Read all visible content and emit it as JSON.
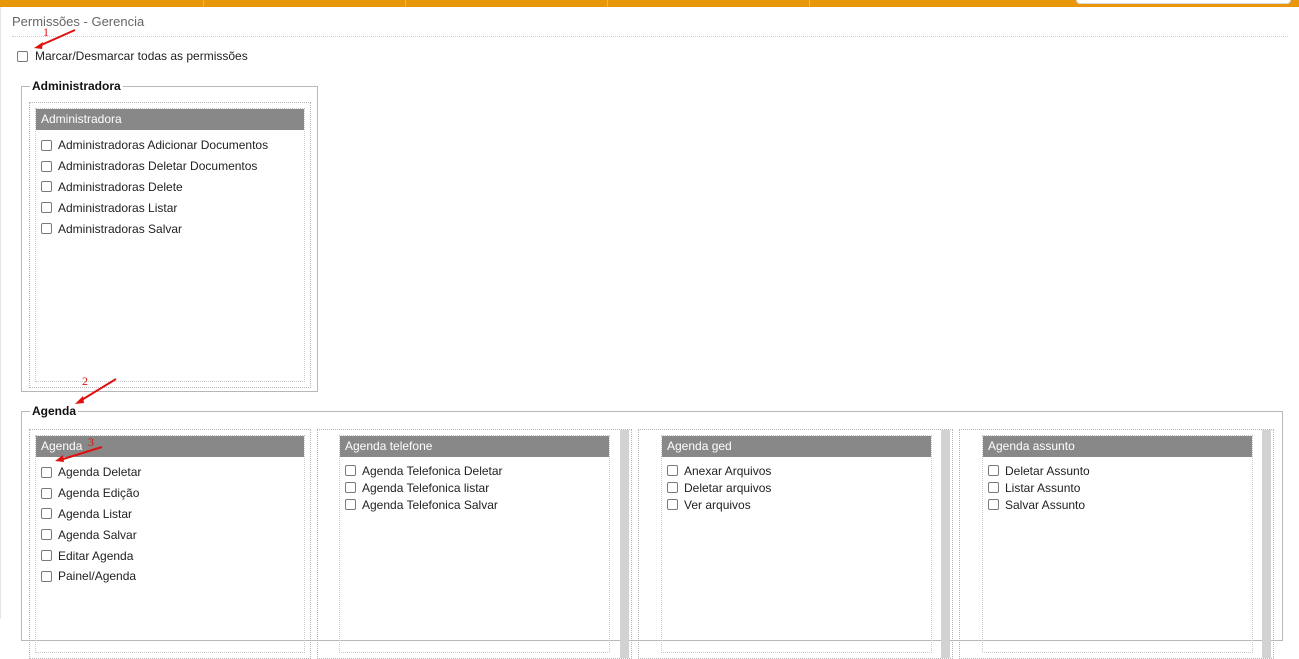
{
  "page": {
    "title": "Permissões - Gerencia"
  },
  "check_all": {
    "label": "Marcar/Desmarcar todas as permissões"
  },
  "groups": {
    "administradora": {
      "legend": "Administradora",
      "panels": [
        {
          "header": "Administradora",
          "items": [
            "Administradoras Adicionar Documentos",
            "Administradoras Deletar Documentos",
            "Administradoras Delete",
            "Administradoras Listar",
            "Administradoras Salvar"
          ]
        }
      ]
    },
    "agenda": {
      "legend": "Agenda",
      "panels": [
        {
          "header": "Agenda",
          "items": [
            "Agenda Deletar",
            "Agenda Edição",
            "Agenda Listar",
            "Agenda Salvar",
            "Editar Agenda",
            "Painel/Agenda"
          ]
        },
        {
          "header": "Agenda telefone",
          "items": [
            "Agenda Telefonica Deletar",
            "Agenda Telefonica listar",
            "Agenda Telefonica Salvar"
          ]
        },
        {
          "header": "Agenda ged",
          "items": [
            "Anexar Arquivos",
            "Deletar arquivos",
            "Ver arquivos"
          ]
        },
        {
          "header": "Agenda assunto",
          "items": [
            "Deletar Assunto",
            "Listar Assunto",
            "Salvar Assunto"
          ]
        }
      ]
    }
  },
  "annotations": {
    "m1": "1",
    "m2": "2",
    "m3": "3"
  },
  "colors": {
    "topbar": "#e8960a",
    "panel_header": "#888888",
    "annotation": "#e01010"
  }
}
